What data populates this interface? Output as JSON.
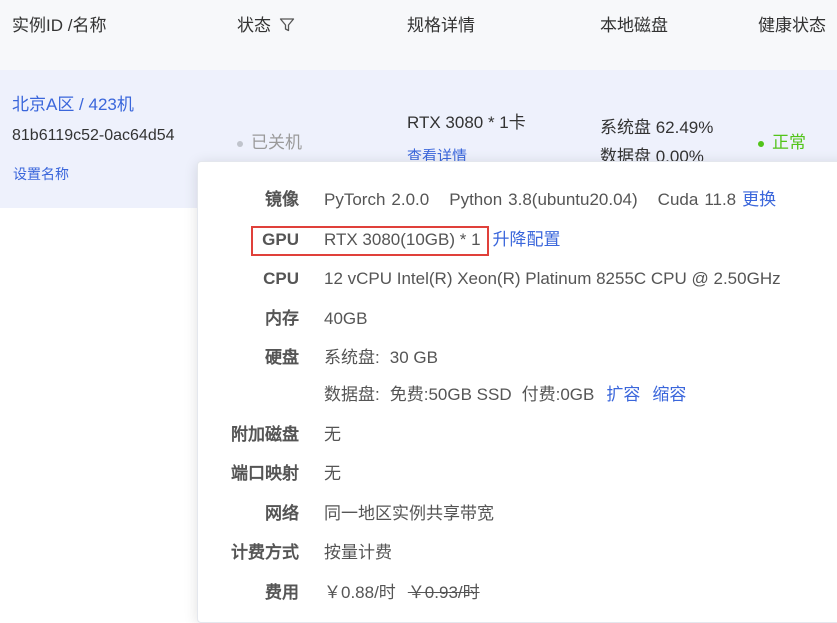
{
  "header": {
    "col_instance": "实例ID /名称",
    "col_status": "状态",
    "col_spec": "规格详情",
    "col_disk": "本地磁盘",
    "col_health": "健康状态"
  },
  "row": {
    "name": "北京A区 / 423机",
    "instance_id": "81b6119c52-0ac64d54",
    "set_name": "设置名称",
    "status": "已关机",
    "spec": "RTX 3080 * 1卡",
    "spec_link": "查看详情",
    "sys_disk": "系统盘 62.49%",
    "data_disk": "数据盘 0.00%",
    "health": "正常"
  },
  "colors": {
    "link": "#3a66db",
    "healthy": "#52c41a",
    "offline_dot": "#c0c4cc",
    "highlight_border": "#e0403a",
    "row_bg": "#eef1fc"
  },
  "popover": {
    "image": {
      "label": "镜像",
      "framework": "PyTorch",
      "framework_ver": "2.0.0",
      "python": "Python",
      "python_ver": "3.8(ubuntu20.04)",
      "cuda": "Cuda",
      "cuda_ver": "11.8",
      "change_link": "更换"
    },
    "gpu": {
      "label": "GPU",
      "value": "RTX 3080(10GB) * 1",
      "link": "升降配置"
    },
    "cpu": {
      "label": "CPU",
      "value": "12 vCPU Intel(R) Xeon(R) Platinum 8255C CPU @ 2.50GHz"
    },
    "memory": {
      "label": "内存",
      "value": "40GB"
    },
    "disk": {
      "label": "硬盘",
      "sys_label": "系统盘:",
      "sys_value": "30 GB",
      "data_label": "数据盘:",
      "data_free": "免费:50GB SSD",
      "data_paid": "付费:0GB",
      "expand_link": "扩容",
      "shrink_link": "缩容"
    },
    "extra_disk": {
      "label": "附加磁盘",
      "value": "无"
    },
    "port_map": {
      "label": "端口映射",
      "value": "无"
    },
    "network": {
      "label": "网络",
      "value": "同一地区实例共享带宽"
    },
    "billing": {
      "label": "计费方式",
      "value": "按量计费"
    },
    "fee": {
      "label": "费用",
      "price": "￥0.88/时",
      "original_price": "￥0.93/时"
    }
  }
}
